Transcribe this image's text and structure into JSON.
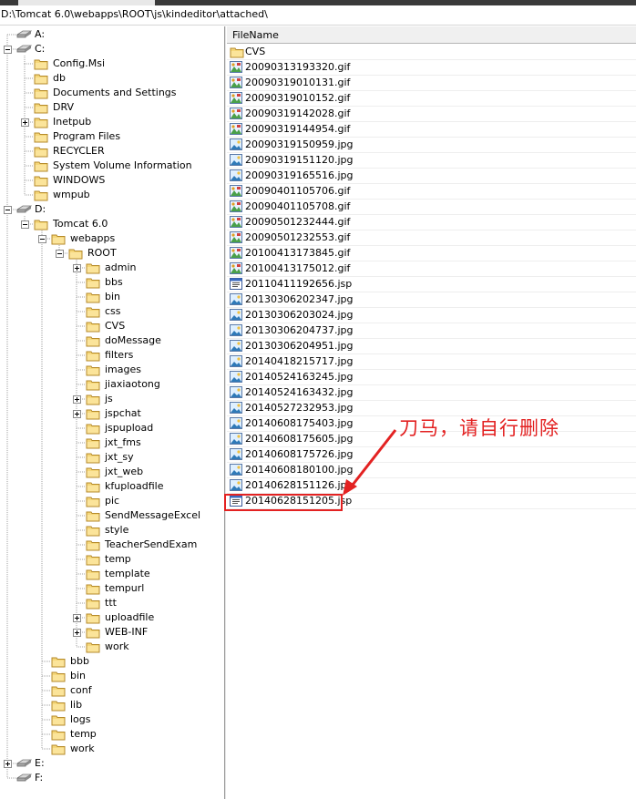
{
  "window": {
    "path": "D:\\Tomcat 6.0\\webapps\\ROOT\\js\\kindeditor\\attached\\"
  },
  "tree": {
    "nodes": [
      {
        "label": "A:",
        "depth": 0,
        "kind": "drive",
        "expander": ""
      },
      {
        "label": "C:",
        "depth": 0,
        "kind": "drive",
        "expander": "minus"
      },
      {
        "label": "Config.Msi",
        "depth": 1,
        "kind": "folder",
        "expander": ""
      },
      {
        "label": "db",
        "depth": 1,
        "kind": "folder",
        "expander": ""
      },
      {
        "label": "Documents and Settings",
        "depth": 1,
        "kind": "folder",
        "expander": ""
      },
      {
        "label": "DRV",
        "depth": 1,
        "kind": "folder",
        "expander": ""
      },
      {
        "label": "Inetpub",
        "depth": 1,
        "kind": "folder",
        "expander": "plus"
      },
      {
        "label": "Program Files",
        "depth": 1,
        "kind": "folder",
        "expander": ""
      },
      {
        "label": "RECYCLER",
        "depth": 1,
        "kind": "folder",
        "expander": ""
      },
      {
        "label": "System Volume Information",
        "depth": 1,
        "kind": "folder",
        "expander": ""
      },
      {
        "label": "WINDOWS",
        "depth": 1,
        "kind": "folder",
        "expander": ""
      },
      {
        "label": "wmpub",
        "depth": 1,
        "kind": "folder",
        "expander": ""
      },
      {
        "label": "D:",
        "depth": 0,
        "kind": "drive",
        "expander": "minus"
      },
      {
        "label": "Tomcat 6.0",
        "depth": 1,
        "kind": "folder",
        "expander": "minus"
      },
      {
        "label": "webapps",
        "depth": 2,
        "kind": "folder",
        "expander": "minus"
      },
      {
        "label": "ROOT",
        "depth": 3,
        "kind": "folder",
        "expander": "minus"
      },
      {
        "label": "admin",
        "depth": 4,
        "kind": "folder",
        "expander": "plus"
      },
      {
        "label": "bbs",
        "depth": 4,
        "kind": "folder",
        "expander": ""
      },
      {
        "label": "bin",
        "depth": 4,
        "kind": "folder",
        "expander": ""
      },
      {
        "label": "css",
        "depth": 4,
        "kind": "folder",
        "expander": ""
      },
      {
        "label": "CVS",
        "depth": 4,
        "kind": "folder",
        "expander": ""
      },
      {
        "label": "doMessage",
        "depth": 4,
        "kind": "folder",
        "expander": ""
      },
      {
        "label": "filters",
        "depth": 4,
        "kind": "folder",
        "expander": ""
      },
      {
        "label": "images",
        "depth": 4,
        "kind": "folder",
        "expander": ""
      },
      {
        "label": "jiaxiaotong",
        "depth": 4,
        "kind": "folder",
        "expander": ""
      },
      {
        "label": "js",
        "depth": 4,
        "kind": "folder",
        "expander": "plus"
      },
      {
        "label": "jspchat",
        "depth": 4,
        "kind": "folder",
        "expander": "plus"
      },
      {
        "label": "jspupload",
        "depth": 4,
        "kind": "folder",
        "expander": ""
      },
      {
        "label": "jxt_fms",
        "depth": 4,
        "kind": "folder",
        "expander": ""
      },
      {
        "label": "jxt_sy",
        "depth": 4,
        "kind": "folder",
        "expander": ""
      },
      {
        "label": "jxt_web",
        "depth": 4,
        "kind": "folder",
        "expander": ""
      },
      {
        "label": "kfuploadfile",
        "depth": 4,
        "kind": "folder",
        "expander": ""
      },
      {
        "label": "pic",
        "depth": 4,
        "kind": "folder",
        "expander": ""
      },
      {
        "label": "SendMessageExcel",
        "depth": 4,
        "kind": "folder",
        "expander": ""
      },
      {
        "label": "style",
        "depth": 4,
        "kind": "folder",
        "expander": ""
      },
      {
        "label": "TeacherSendExam",
        "depth": 4,
        "kind": "folder",
        "expander": ""
      },
      {
        "label": "temp",
        "depth": 4,
        "kind": "folder",
        "expander": ""
      },
      {
        "label": "template",
        "depth": 4,
        "kind": "folder",
        "expander": ""
      },
      {
        "label": "tempurl",
        "depth": 4,
        "kind": "folder",
        "expander": ""
      },
      {
        "label": "ttt",
        "depth": 4,
        "kind": "folder",
        "expander": ""
      },
      {
        "label": "uploadfile",
        "depth": 4,
        "kind": "folder",
        "expander": "plus"
      },
      {
        "label": "WEB-INF",
        "depth": 4,
        "kind": "folder",
        "expander": "plus"
      },
      {
        "label": "work",
        "depth": 4,
        "kind": "folder",
        "expander": ""
      },
      {
        "label": "bbb",
        "depth": 2,
        "kind": "folder",
        "expander": ""
      },
      {
        "label": "bin",
        "depth": 2,
        "kind": "folder",
        "expander": ""
      },
      {
        "label": "conf",
        "depth": 2,
        "kind": "folder",
        "expander": ""
      },
      {
        "label": "lib",
        "depth": 2,
        "kind": "folder",
        "expander": ""
      },
      {
        "label": "logs",
        "depth": 2,
        "kind": "folder",
        "expander": ""
      },
      {
        "label": "temp",
        "depth": 2,
        "kind": "folder",
        "expander": ""
      },
      {
        "label": "work",
        "depth": 2,
        "kind": "folder",
        "expander": ""
      },
      {
        "label": "E:",
        "depth": 0,
        "kind": "drive",
        "expander": "plus"
      },
      {
        "label": "F:",
        "depth": 0,
        "kind": "drive",
        "expander": ""
      }
    ]
  },
  "files": {
    "column_header": "FileName",
    "items": [
      {
        "name": "CVS",
        "icon": "folder-icon"
      },
      {
        "name": "20090313193320.gif",
        "icon": "gif-image-icon"
      },
      {
        "name": "20090319010131.gif",
        "icon": "gif-image-icon"
      },
      {
        "name": "20090319010152.gif",
        "icon": "gif-image-icon"
      },
      {
        "name": "20090319142028.gif",
        "icon": "gif-image-icon"
      },
      {
        "name": "20090319144954.gif",
        "icon": "gif-image-icon"
      },
      {
        "name": "20090319150959.jpg",
        "icon": "jpg-image-icon"
      },
      {
        "name": "20090319151120.jpg",
        "icon": "jpg-image-icon"
      },
      {
        "name": "20090319165516.jpg",
        "icon": "jpg-image-icon"
      },
      {
        "name": "20090401105706.gif",
        "icon": "gif-image-icon"
      },
      {
        "name": "20090401105708.gif",
        "icon": "gif-image-icon"
      },
      {
        "name": "20090501232444.gif",
        "icon": "gif-image-icon"
      },
      {
        "name": "20090501232553.gif",
        "icon": "gif-image-icon"
      },
      {
        "name": "20100413173845.gif",
        "icon": "gif-image-icon"
      },
      {
        "name": "20100413175012.gif",
        "icon": "gif-image-icon"
      },
      {
        "name": "20110411192656.jsp",
        "icon": "jsp-file-icon"
      },
      {
        "name": "20130306202347.jpg",
        "icon": "jpg-image-icon"
      },
      {
        "name": "20130306203024.jpg",
        "icon": "jpg-image-icon"
      },
      {
        "name": "20130306204737.jpg",
        "icon": "jpg-image-icon"
      },
      {
        "name": "20130306204951.jpg",
        "icon": "jpg-image-icon"
      },
      {
        "name": "20140418215717.jpg",
        "icon": "jpg-image-icon"
      },
      {
        "name": "20140524163245.jpg",
        "icon": "jpg-image-icon"
      },
      {
        "name": "20140524163432.jpg",
        "icon": "jpg-image-icon"
      },
      {
        "name": "20140527232953.jpg",
        "icon": "jpg-image-icon"
      },
      {
        "name": "20140608175403.jpg",
        "icon": "jpg-image-icon"
      },
      {
        "name": "20140608175605.jpg",
        "icon": "jpg-image-icon"
      },
      {
        "name": "20140608175726.jpg",
        "icon": "jpg-image-icon"
      },
      {
        "name": "20140608180100.jpg",
        "icon": "jpg-image-icon"
      },
      {
        "name": "20140628151126.jpg",
        "icon": "jpg-image-icon"
      },
      {
        "name": "20140628151205.jsp",
        "icon": "jsp-file-icon"
      }
    ]
  },
  "annotation": {
    "text": "刀马，请自行删除",
    "color": "#e32222"
  }
}
